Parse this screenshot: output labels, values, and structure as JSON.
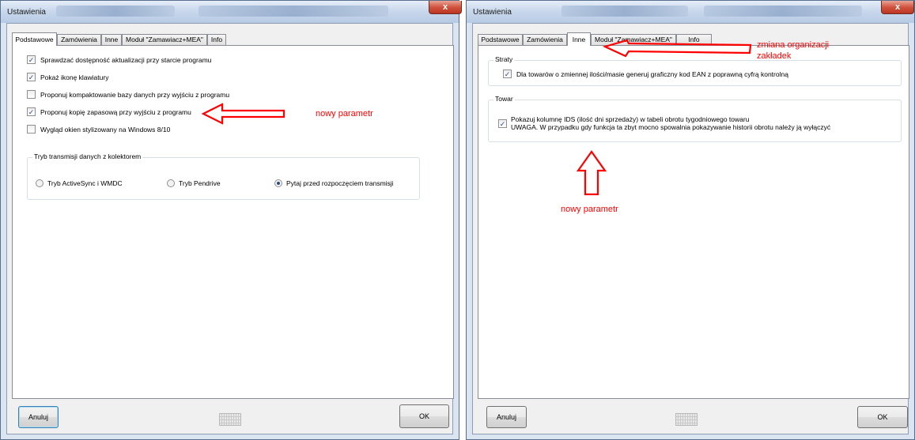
{
  "colors": {
    "annotation": "#ff0000",
    "window_frame": "#dbe4f1",
    "close_button": "#c9412b"
  },
  "left_window": {
    "title": "Ustawienia",
    "close_glyph": "x",
    "tabs": [
      "Podstawowe",
      "Zamówienia",
      "Inne",
      "Moduł \"Zamawiacz+MEA\"",
      "Info"
    ],
    "active_tab": "Podstawowe",
    "options": [
      {
        "label": "Sprawdzać dostępność aktualizacji przy starcie programu",
        "checked": true
      },
      {
        "label": "Pokaż ikonę klawiatury",
        "checked": true
      },
      {
        "label": "Proponuj kompaktowanie bazy danych przy wyjściu z programu",
        "checked": false
      },
      {
        "label": "Proponuj kopię zapasową przy wyjściu z programu",
        "checked": true
      },
      {
        "label": "Wygląd okien stylizowany na Windows 8/10",
        "checked": false
      }
    ],
    "transmission": {
      "title": "Tryb transmisji danych z kolektorem",
      "options": [
        {
          "label": "Tryb ActiveSync i WMDC",
          "selected": false
        },
        {
          "label": "Tryb Pendrive",
          "selected": false
        },
        {
          "label": "Pytaj przed rozpoczęciem transmisji",
          "selected": true
        }
      ]
    },
    "cancel_label": "Anuluj",
    "ok_label": "OK",
    "keyboard_icon": "keyboard-icon"
  },
  "right_window": {
    "title": "Ustawienia",
    "close_glyph": "x",
    "tabs": [
      "Podstawowe",
      "Zamówienia",
      "Inne",
      "Moduł \"Zamawiacz+MEA\"",
      "Info"
    ],
    "active_tab": "Inne",
    "straty": {
      "title": "Straty",
      "option": {
        "label": "Dla towarów o zmiennej ilości/masie generuj graficzny kod EAN z poprawną cyfrą kontrolną",
        "checked": true
      }
    },
    "towar": {
      "title": "Towar",
      "option": {
        "line1": "Pokazuj kolumnę IDS (ilość dni sprzedaży)  w tabeli obrotu tygodniowego towaru",
        "line2": "UWAGA. W przypadku gdy funkcja ta zbyt mocno spowalnia pokazywanie historii obrotu należy ją wyłączyć",
        "checked": true
      }
    },
    "cancel_label": "Anuluj",
    "ok_label": "OK",
    "keyboard_icon": "keyboard-icon"
  },
  "annotations": {
    "new_param_left": "nowy parametr",
    "tabs_reorg_line1": "zmiana organizacji",
    "tabs_reorg_line2": "zakładek",
    "new_param_right": "nowy parametr"
  }
}
